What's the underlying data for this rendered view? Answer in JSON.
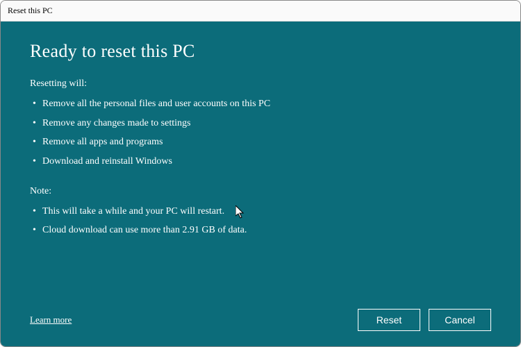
{
  "window": {
    "title": "Reset this PC"
  },
  "heading": "Ready to reset this PC",
  "resetting_label": "Resetting will:",
  "resetting_bullets": [
    "Remove all the personal files and user accounts on this PC",
    "Remove any changes made to settings",
    "Remove all apps and programs",
    "Download and reinstall Windows"
  ],
  "note_label": "Note:",
  "note_bullets": [
    "This will take a while and your PC will restart.",
    "Cloud download can use more than 2.91 GB of data."
  ],
  "footer": {
    "learn_more": "Learn more",
    "reset_button": "Reset",
    "cancel_button": "Cancel"
  }
}
